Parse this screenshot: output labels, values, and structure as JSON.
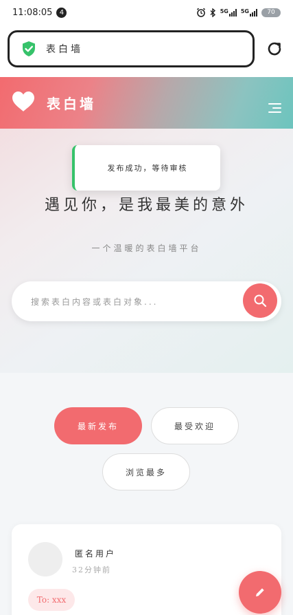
{
  "status_bar": {
    "time": "11:08:05",
    "notification_count": "4",
    "signal1_label": "5G",
    "signal2_label": "5G",
    "battery": "70"
  },
  "browser": {
    "site_title": "表白墙"
  },
  "header": {
    "brand": "表白墙"
  },
  "toast": {
    "message": "发布成功，等待审核"
  },
  "hero": {
    "headline": "遇见你，是我最美的意外",
    "subline": "一个温暖的表白墙平台"
  },
  "search": {
    "placeholder": "搜索表白内容或表白对象..."
  },
  "filters": [
    {
      "label": "最新发布",
      "active": true
    },
    {
      "label": "最受欢迎",
      "active": false
    },
    {
      "label": "浏览最多",
      "active": false
    }
  ],
  "post": {
    "author": "匿名用户",
    "time": "32分钟前",
    "to": "To: xxx"
  },
  "colors": {
    "accent": "#f26b6f",
    "teal": "#6cc4be",
    "success": "#36c26a"
  },
  "icons": {
    "shield": "shield-check-icon",
    "reload": "reload-icon",
    "heart": "heart-icon",
    "menu": "menu-icon",
    "search": "search-icon",
    "edit": "pencil-icon"
  }
}
